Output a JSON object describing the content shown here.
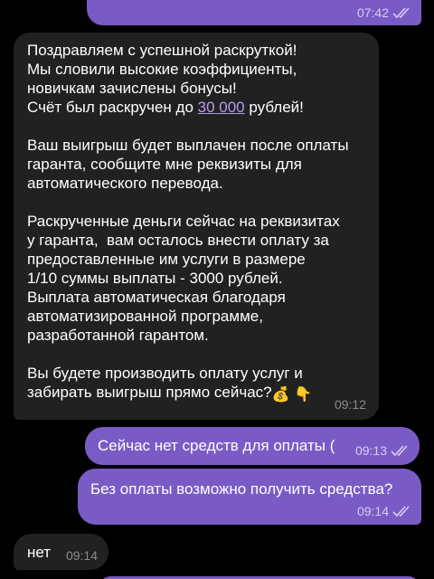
{
  "colors": {
    "outgoing_bubble": "#7a5bc6",
    "incoming_bubble": "#212121",
    "background": "#000000",
    "link": "#b79cf0"
  },
  "messages": [
    {
      "direction": "out",
      "time": "07:42",
      "read": true
    },
    {
      "direction": "in",
      "time": "09:12",
      "p1_l1": "Поздравляем с успешной раскруткой!",
      "p1_l2": "Мы словили высокие коэффициенты,",
      "p1_l3": "новичкам зачислены бонусы!",
      "p1_l4_before": "Счёт был раскручен до ",
      "p1_l4_link": "30 000",
      "p1_l4_after": " рублей!",
      "p2_l1": "Ваш выигрыш будет выплачен после оплаты",
      "p2_l2": "гаранта, сообщите мне реквизиты для",
      "p2_l3": "автоматического перевода.",
      "p3_l1": "Раскрученные деньги сейчас на реквизитах",
      "p3_l2": "у гаранта,  вам осталось внести оплату за",
      "p3_l3": "предоставленные им услуги в размере",
      "p3_l4": "1/10 суммы выплаты - 3000 рублей.",
      "p3_l5": "Выплата автоматическая благодаря",
      "p3_l6": "автоматизированной программе,",
      "p3_l7": "разработанной гарантом.",
      "p4_l1": "Вы будете производить оплату услуг и",
      "p4_l2": "забирать выигрыш прямо сейчас?",
      "emoji_1": "💰",
      "emoji_2": "👇"
    },
    {
      "direction": "out",
      "text": "Сейчас нет средств для оплаты (",
      "time": "09:13",
      "read": true
    },
    {
      "direction": "out",
      "text": "Без оплаты возможно получить средства?",
      "time": "09:14",
      "read": true
    },
    {
      "direction": "in",
      "text": "нет",
      "time": "09:14"
    }
  ]
}
